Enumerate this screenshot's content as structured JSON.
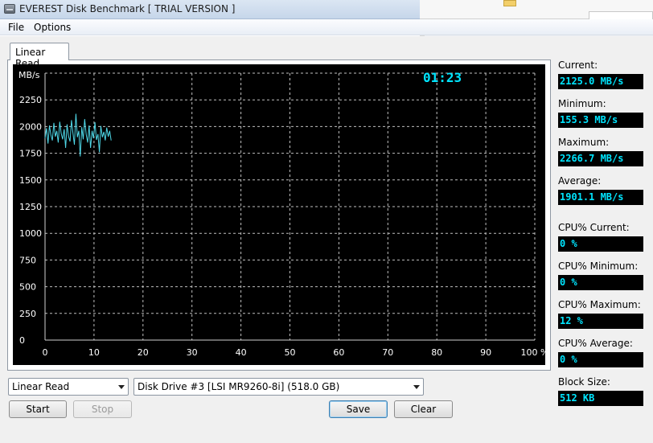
{
  "window": {
    "title": "EVEREST Disk Benchmark  [ TRIAL VERSION ]"
  },
  "menu": {
    "file": "File",
    "options": "Options"
  },
  "tab": {
    "label": "Linear Read"
  },
  "timer": "01:23",
  "chart_data": {
    "type": "line",
    "title": "",
    "ylabel": "MB/s",
    "xlabel": "",
    "x_tick_labels": [
      "0",
      "10",
      "20",
      "30",
      "40",
      "50",
      "60",
      "70",
      "80",
      "90",
      "100 %"
    ],
    "y_tick_labels": [
      "0",
      "250",
      "500",
      "750",
      "1000",
      "1250",
      "1500",
      "1750",
      "2000",
      "2250"
    ],
    "xlim": [
      0,
      100
    ],
    "ylim": [
      0,
      2500
    ],
    "grid": true,
    "line_color": "#4fd8e8",
    "series": [
      {
        "x": [
          0,
          0.3,
          0.6,
          0.9,
          1.2,
          1.5,
          1.8,
          2.1,
          2.4,
          2.7,
          3.0,
          3.3,
          3.6,
          3.9,
          4.2,
          4.5,
          4.8,
          5.1,
          5.4,
          5.7,
          6.0,
          6.3,
          6.6,
          6.9,
          7.2,
          7.5,
          7.8,
          8.1,
          8.4,
          8.7,
          9.0,
          9.3,
          9.6,
          9.9,
          10.2,
          10.5,
          10.8,
          11.1,
          11.4,
          11.7,
          12.0,
          12.3,
          12.6,
          12.9,
          13.2,
          13.5
        ],
        "values": [
          1890,
          1985,
          1840,
          2010,
          1920,
          1870,
          2035,
          1905,
          1960,
          1850,
          2045,
          1935,
          1880,
          1975,
          1800,
          2020,
          1910,
          1860,
          2060,
          1940,
          1830,
          2120,
          1900,
          1960,
          1720,
          1995,
          1880,
          2070,
          1925,
          1850,
          2010,
          1800,
          1960,
          1890,
          2040,
          1875,
          1930,
          1760,
          2005,
          1900,
          1950,
          1870,
          1990,
          1905,
          1960,
          1870
        ]
      }
    ]
  },
  "controls": {
    "mode_select": "Linear Read",
    "drive_select": "Disk Drive #3  [LSI MR9260-8i]  (518.0 GB)",
    "start": "Start",
    "stop": "Stop",
    "save": "Save",
    "clear": "Clear"
  },
  "stats": {
    "current_label": "Current:",
    "current_value": "2125.0 MB/s",
    "minimum_label": "Minimum:",
    "minimum_value": "155.3 MB/s",
    "maximum_label": "Maximum:",
    "maximum_value": "2266.7 MB/s",
    "average_label": "Average:",
    "average_value": "1901.1 MB/s",
    "cpu_current_label": "CPU% Current:",
    "cpu_current_value": "0 %",
    "cpu_minimum_label": "CPU% Minimum:",
    "cpu_minimum_value": "0 %",
    "cpu_maximum_label": "CPU% Maximum:",
    "cpu_maximum_value": "12 %",
    "cpu_average_label": "CPU% Average:",
    "cpu_average_value": "0 %",
    "block_size_label": "Block Size:",
    "block_size_value": "512 KB"
  }
}
